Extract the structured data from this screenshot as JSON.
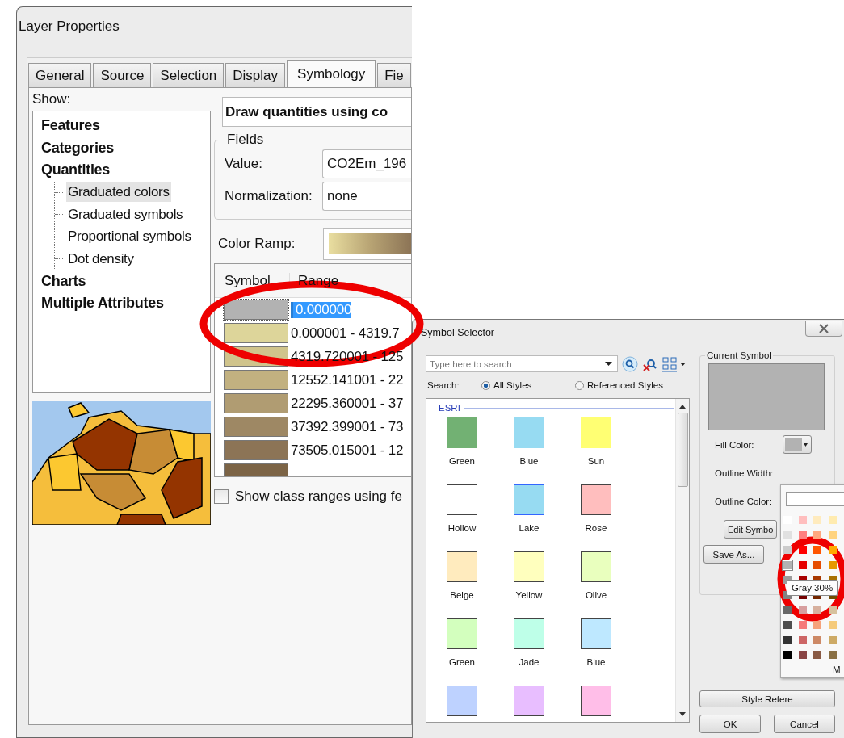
{
  "layer_properties": {
    "title": "Layer Properties",
    "tabs": [
      {
        "label": "General",
        "selected": false
      },
      {
        "label": "Source",
        "selected": false
      },
      {
        "label": "Selection",
        "selected": false
      },
      {
        "label": "Display",
        "selected": false
      },
      {
        "label": "Symbology",
        "selected": true
      },
      {
        "label": "Fie",
        "selected": false
      }
    ],
    "show_label": "Show:",
    "tree": [
      {
        "label": "Features",
        "selected": false
      },
      {
        "label": "Categories",
        "selected": false
      },
      {
        "label": "Quantities",
        "selected": false,
        "children": [
          {
            "label": "Graduated colors",
            "selected": true
          },
          {
            "label": "Graduated symbols",
            "selected": false
          },
          {
            "label": "Proportional symbols",
            "selected": false
          },
          {
            "label": "Dot density",
            "selected": false
          }
        ]
      },
      {
        "label": "Charts",
        "selected": false
      },
      {
        "label": "Multiple Attributes",
        "selected": false
      }
    ],
    "heading": "Draw quantities using co",
    "fields": {
      "title": "Fields",
      "value_label": "Value:",
      "value": "CO2Em_196",
      "normalization_label": "Normalization:",
      "normalization": "none"
    },
    "color_ramp_label": "Color Ramp:",
    "classes": {
      "columns": [
        "Symbol",
        "Range"
      ],
      "rows": [
        {
          "color": "#b2b2b2",
          "range": "0.000000",
          "selected": true
        },
        {
          "color": "#ddd59a",
          "range": "0.000001 - 4319.7",
          "selected": false
        },
        {
          "color": "#d0c48c",
          "range": "4319.720001 - 125",
          "selected": false
        },
        {
          "color": "#c2b180",
          "range": "12552.141001 - 22",
          "selected": false
        },
        {
          "color": "#b09c72",
          "range": "22295.360001 - 37",
          "selected": false
        },
        {
          "color": "#9e8864",
          "range": "37392.399001 - 73",
          "selected": false
        },
        {
          "color": "#8c7456",
          "range": "73505.015001 - 12",
          "selected": false
        },
        {
          "color": "#7c6446",
          "selected": false
        }
      ]
    },
    "show_class_ranges": {
      "label": "Show class ranges using fe",
      "checked": false
    }
  },
  "symbol_selector": {
    "title": "Symbol Selector",
    "search": {
      "placeholder": "Type here to search"
    },
    "search_label": "Search:",
    "scopes": [
      {
        "label": "All Styles",
        "selected": true
      },
      {
        "label": "Referenced Styles",
        "selected": false
      }
    ],
    "group": "ESRI",
    "symbols": [
      {
        "name": "Green",
        "color": "#72b173",
        "outlined": false,
        "selected": false
      },
      {
        "name": "Blue",
        "color": "#97dbf2",
        "outlined": false,
        "selected": false
      },
      {
        "name": "Sun",
        "color": "#ffff73",
        "outlined": false,
        "selected": false
      },
      {
        "name": "Hollow",
        "color": "#ffffff",
        "outlined": true,
        "selected": false
      },
      {
        "name": "Lake",
        "color": "#97dbf2",
        "outlined": true,
        "selected": true
      },
      {
        "name": "Rose",
        "color": "#ffbebe",
        "outlined": true,
        "selected": false
      },
      {
        "name": "Beige",
        "color": "#ffebbe",
        "outlined": true,
        "selected": false
      },
      {
        "name": "Yellow",
        "color": "#ffffbe",
        "outlined": true,
        "selected": false
      },
      {
        "name": "Olive",
        "color": "#e9ffbe",
        "outlined": true,
        "selected": false
      },
      {
        "name": "Green",
        "color": "#d3ffbe",
        "outlined": true,
        "selected": false
      },
      {
        "name": "Jade",
        "color": "#beffe8",
        "outlined": true,
        "selected": false
      },
      {
        "name": "Blue",
        "color": "#bee8ff",
        "outlined": true,
        "selected": false
      },
      {
        "color": "#bed2ff",
        "outlined": true,
        "selected": false
      },
      {
        "color": "#e8beff",
        "outlined": true,
        "selected": false
      },
      {
        "color": "#ffbee8",
        "outlined": true,
        "selected": false
      }
    ],
    "current_symbol": "Current Symbol",
    "fill_color_label": "Fill Color:",
    "outline_width_label": "Outline Width:",
    "outline_color_label": "Outline Color:",
    "edit_button": "Edit Symbo",
    "save_as_button": "Save As...",
    "style_references_button": "Style Refere",
    "ok_button": "OK",
    "cancel_button": "Cancel",
    "palette": {
      "tooltip": "Gray 30%",
      "more": "M",
      "rows": [
        {
          "cells": [
            {
              "color": "#ffffff",
              "selected": false
            },
            {
              "color": "#ffbebe",
              "selected": false
            },
            {
              "color": "#ffebbe",
              "selected": false
            },
            {
              "color": "#ffebaf",
              "selected": false
            }
          ]
        },
        {
          "cells": [
            {
              "color": "#e1e1e1",
              "selected": false
            },
            {
              "color": "#ff7f7f",
              "selected": false
            },
            {
              "color": "#ffa77f",
              "selected": false
            },
            {
              "color": "#ffd37f",
              "selected": false
            }
          ]
        },
        {
          "cells": [
            {
              "color": "#cccccc",
              "selected": false
            },
            {
              "color": "#ff0000",
              "selected": false
            },
            {
              "color": "#ff5500",
              "selected": false
            },
            {
              "color": "#ffaa00",
              "selected": false
            }
          ]
        },
        {
          "cells": [
            {
              "color": "#b2b2b2",
              "selected": true
            },
            {
              "color": "#e60000",
              "selected": false
            },
            {
              "color": "#e64c00",
              "selected": false
            },
            {
              "color": "#e69800",
              "selected": false
            }
          ]
        },
        {
          "cells": [
            {
              "color": "#9c9c9c",
              "selected": false
            },
            {
              "color": "#a80000",
              "selected": false
            },
            {
              "color": "#a83800",
              "selected": false
            },
            {
              "color": "#a87000",
              "selected": false
            }
          ]
        },
        {
          "cells": [
            {
              "color": "#828282",
              "selected": false
            },
            {
              "color": "#730000",
              "selected": false
            },
            {
              "color": "#732600",
              "selected": false
            },
            {
              "color": "#734c00",
              "selected": false
            }
          ]
        },
        {
          "cells": [
            {
              "color": "#686868",
              "selected": false
            },
            {
              "color": "#d79e9e",
              "selected": false
            },
            {
              "color": "#d7b09e",
              "selected": false
            },
            {
              "color": "#d7c29e",
              "selected": false
            }
          ]
        },
        {
          "cells": [
            {
              "color": "#4e4e4e",
              "selected": false
            },
            {
              "color": "#f57a7a",
              "selected": false
            },
            {
              "color": "#f5a27a",
              "selected": false
            },
            {
              "color": "#f5ca7a",
              "selected": false
            }
          ]
        },
        {
          "cells": [
            {
              "color": "#343434",
              "selected": false
            },
            {
              "color": "#cd6666",
              "selected": false
            },
            {
              "color": "#cd8966",
              "selected": false
            },
            {
              "color": "#cdaa66",
              "selected": false
            }
          ]
        },
        {
          "cells": [
            {
              "color": "#000000",
              "selected": false
            },
            {
              "color": "#894444",
              "selected": false
            },
            {
              "color": "#895a44",
              "selected": false
            },
            {
              "color": "#897044",
              "selected": false
            }
          ]
        }
      ]
    }
  }
}
